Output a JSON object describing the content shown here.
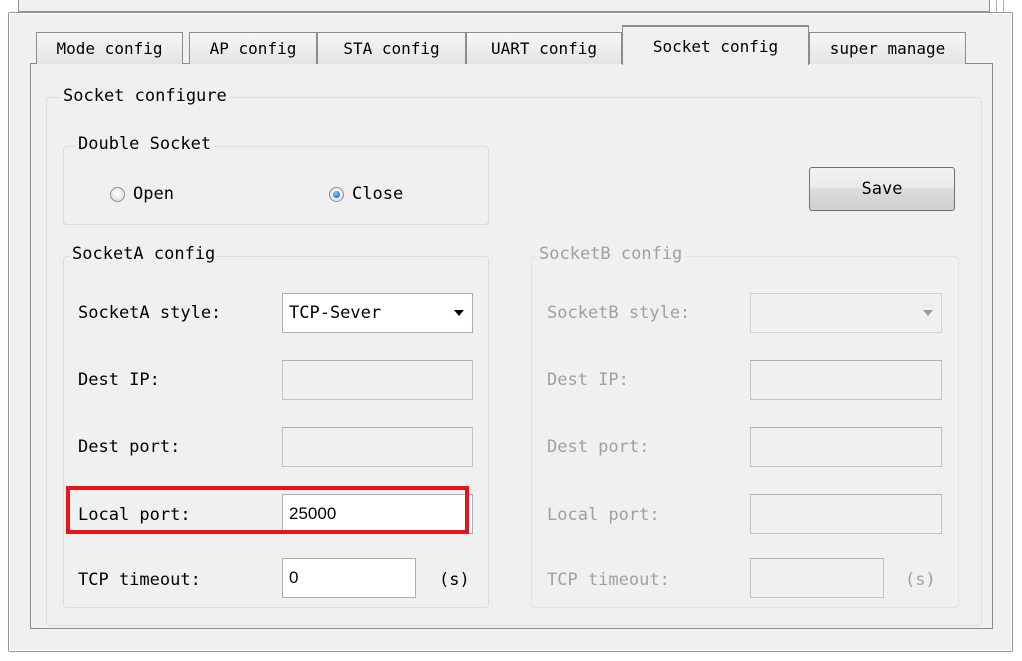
{
  "tabs": [
    {
      "label": "Mode config"
    },
    {
      "label": "AP config"
    },
    {
      "label": "STA config"
    },
    {
      "label": "UART config"
    },
    {
      "label": "Socket config"
    },
    {
      "label": "super manage"
    }
  ],
  "active_tab": "Socket config",
  "socket_configure": {
    "title": "Socket configure",
    "double_socket": {
      "title": "Double Socket",
      "open_label": "Open",
      "close_label": "Close",
      "selected": "Close"
    },
    "save_label": "Save",
    "socket_a": {
      "title": "SocketA config",
      "style_label": "SocketA style:",
      "style_value": "TCP-Sever",
      "dest_ip_label": "Dest IP:",
      "dest_ip_value": "",
      "dest_port_label": "Dest port:",
      "dest_port_value": "",
      "local_port_label": "Local port:",
      "local_port_value": "25000",
      "tcp_timeout_label": "TCP timeout:",
      "tcp_timeout_value": "0",
      "tcp_timeout_unit": "(s)"
    },
    "socket_b": {
      "title": "SocketB config",
      "style_label": "SocketB style:",
      "style_value": "",
      "dest_ip_label": "Dest IP:",
      "dest_port_label": "Dest port:",
      "local_port_label": "Local port:",
      "tcp_timeout_label": "TCP timeout:",
      "tcp_timeout_unit": "(s)"
    }
  },
  "colors": {
    "highlight": "#e8141c",
    "radio_selected": "#0c54b0",
    "disabled_text": "#a0a0a0"
  }
}
